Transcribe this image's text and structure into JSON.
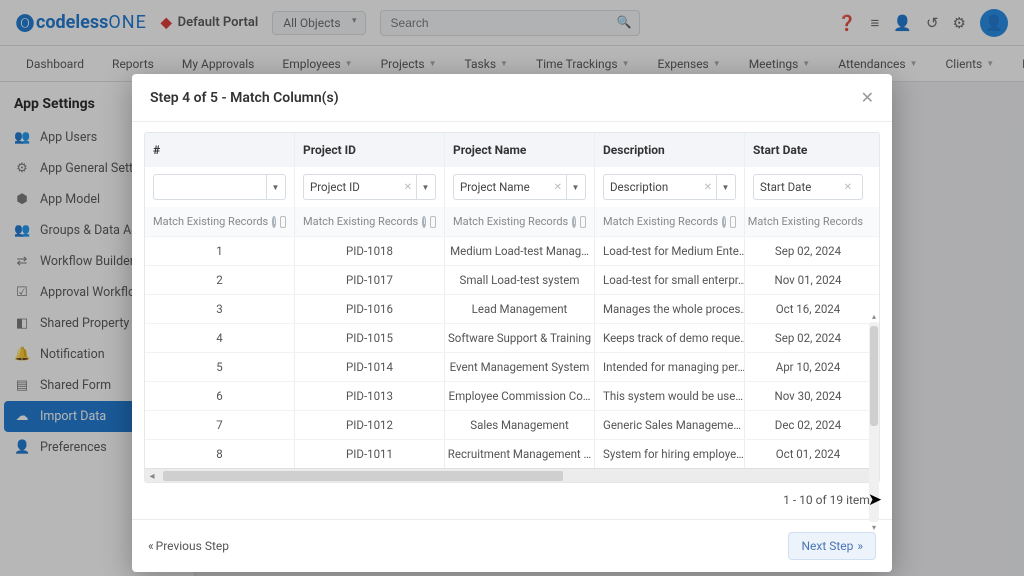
{
  "brand": {
    "codeless": "codeless",
    "one": "ONE"
  },
  "portal": {
    "label": "Default Portal"
  },
  "objectFilter": "All Objects",
  "searchPlaceholder": "Search",
  "nav": {
    "dashboard": "Dashboard",
    "reports": "Reports",
    "approvals": "My Approvals",
    "employees": "Employees",
    "projects": "Projects",
    "tasks": "Tasks",
    "time": "Time Trackings",
    "expenses": "Expenses",
    "meetings": "Meetings",
    "attend": "Attendances",
    "clients": "Clients",
    "milestones": "Milestones"
  },
  "sidebar": {
    "title": "App Settings",
    "items": {
      "users": "App Users",
      "general": "App General Settings",
      "model": "App Model",
      "groups": "Groups & Data Access",
      "workflow": "Workflow Builder",
      "appr": "Approval Workflow",
      "shared": "Shared Property",
      "notif": "Notification",
      "form": "Shared Form",
      "import": "Import Data",
      "pref": "Preferences"
    }
  },
  "modal": {
    "title": "Step 4 of 5 - Match Column(s)",
    "headers": {
      "c0": "#",
      "c1": "Project ID",
      "c2": "Project Name",
      "c3": "Description",
      "c4": "Start Date"
    },
    "selects": {
      "c1": "Project ID",
      "c2": "Project Name",
      "c3": "Description",
      "c4": "Start Date"
    },
    "matchLabel": "Match Existing Records",
    "rows": [
      {
        "n": "1",
        "id": "PID-1018",
        "name": "Medium Load-test Manag…",
        "desc": "Load-test for Medium Ente…",
        "date": "Sep 02, 2024"
      },
      {
        "n": "2",
        "id": "PID-1017",
        "name": "Small Load-test system",
        "desc": "Load-test for small enterpr…",
        "date": "Nov 01, 2024"
      },
      {
        "n": "3",
        "id": "PID-1016",
        "name": "Lead Management",
        "desc": "Manages the whole proces…",
        "date": "Oct 16, 2024"
      },
      {
        "n": "4",
        "id": "PID-1015",
        "name": "Software Support & Training",
        "desc": "Keeps track of demo reque…",
        "date": "Sep 02, 2024"
      },
      {
        "n": "5",
        "id": "PID-1014",
        "name": "Event Management System",
        "desc": "Intended for managing per…",
        "date": "Apr 10, 2024"
      },
      {
        "n": "6",
        "id": "PID-1013",
        "name": "Employee Commission Co…",
        "desc": "This system would be use…",
        "date": "Nov 30, 2024"
      },
      {
        "n": "7",
        "id": "PID-1012",
        "name": "Sales Management",
        "desc": "Generic Sales Manageme…",
        "date": "Dec 02, 2024"
      },
      {
        "n": "8",
        "id": "PID-1011",
        "name": "Recruitment Management …",
        "desc": "System for hiring employe…",
        "date": "Oct 01, 2024"
      }
    ],
    "paging": "1 - 10 of 19 items",
    "prev": "Previous Step",
    "next": "Next Step"
  }
}
